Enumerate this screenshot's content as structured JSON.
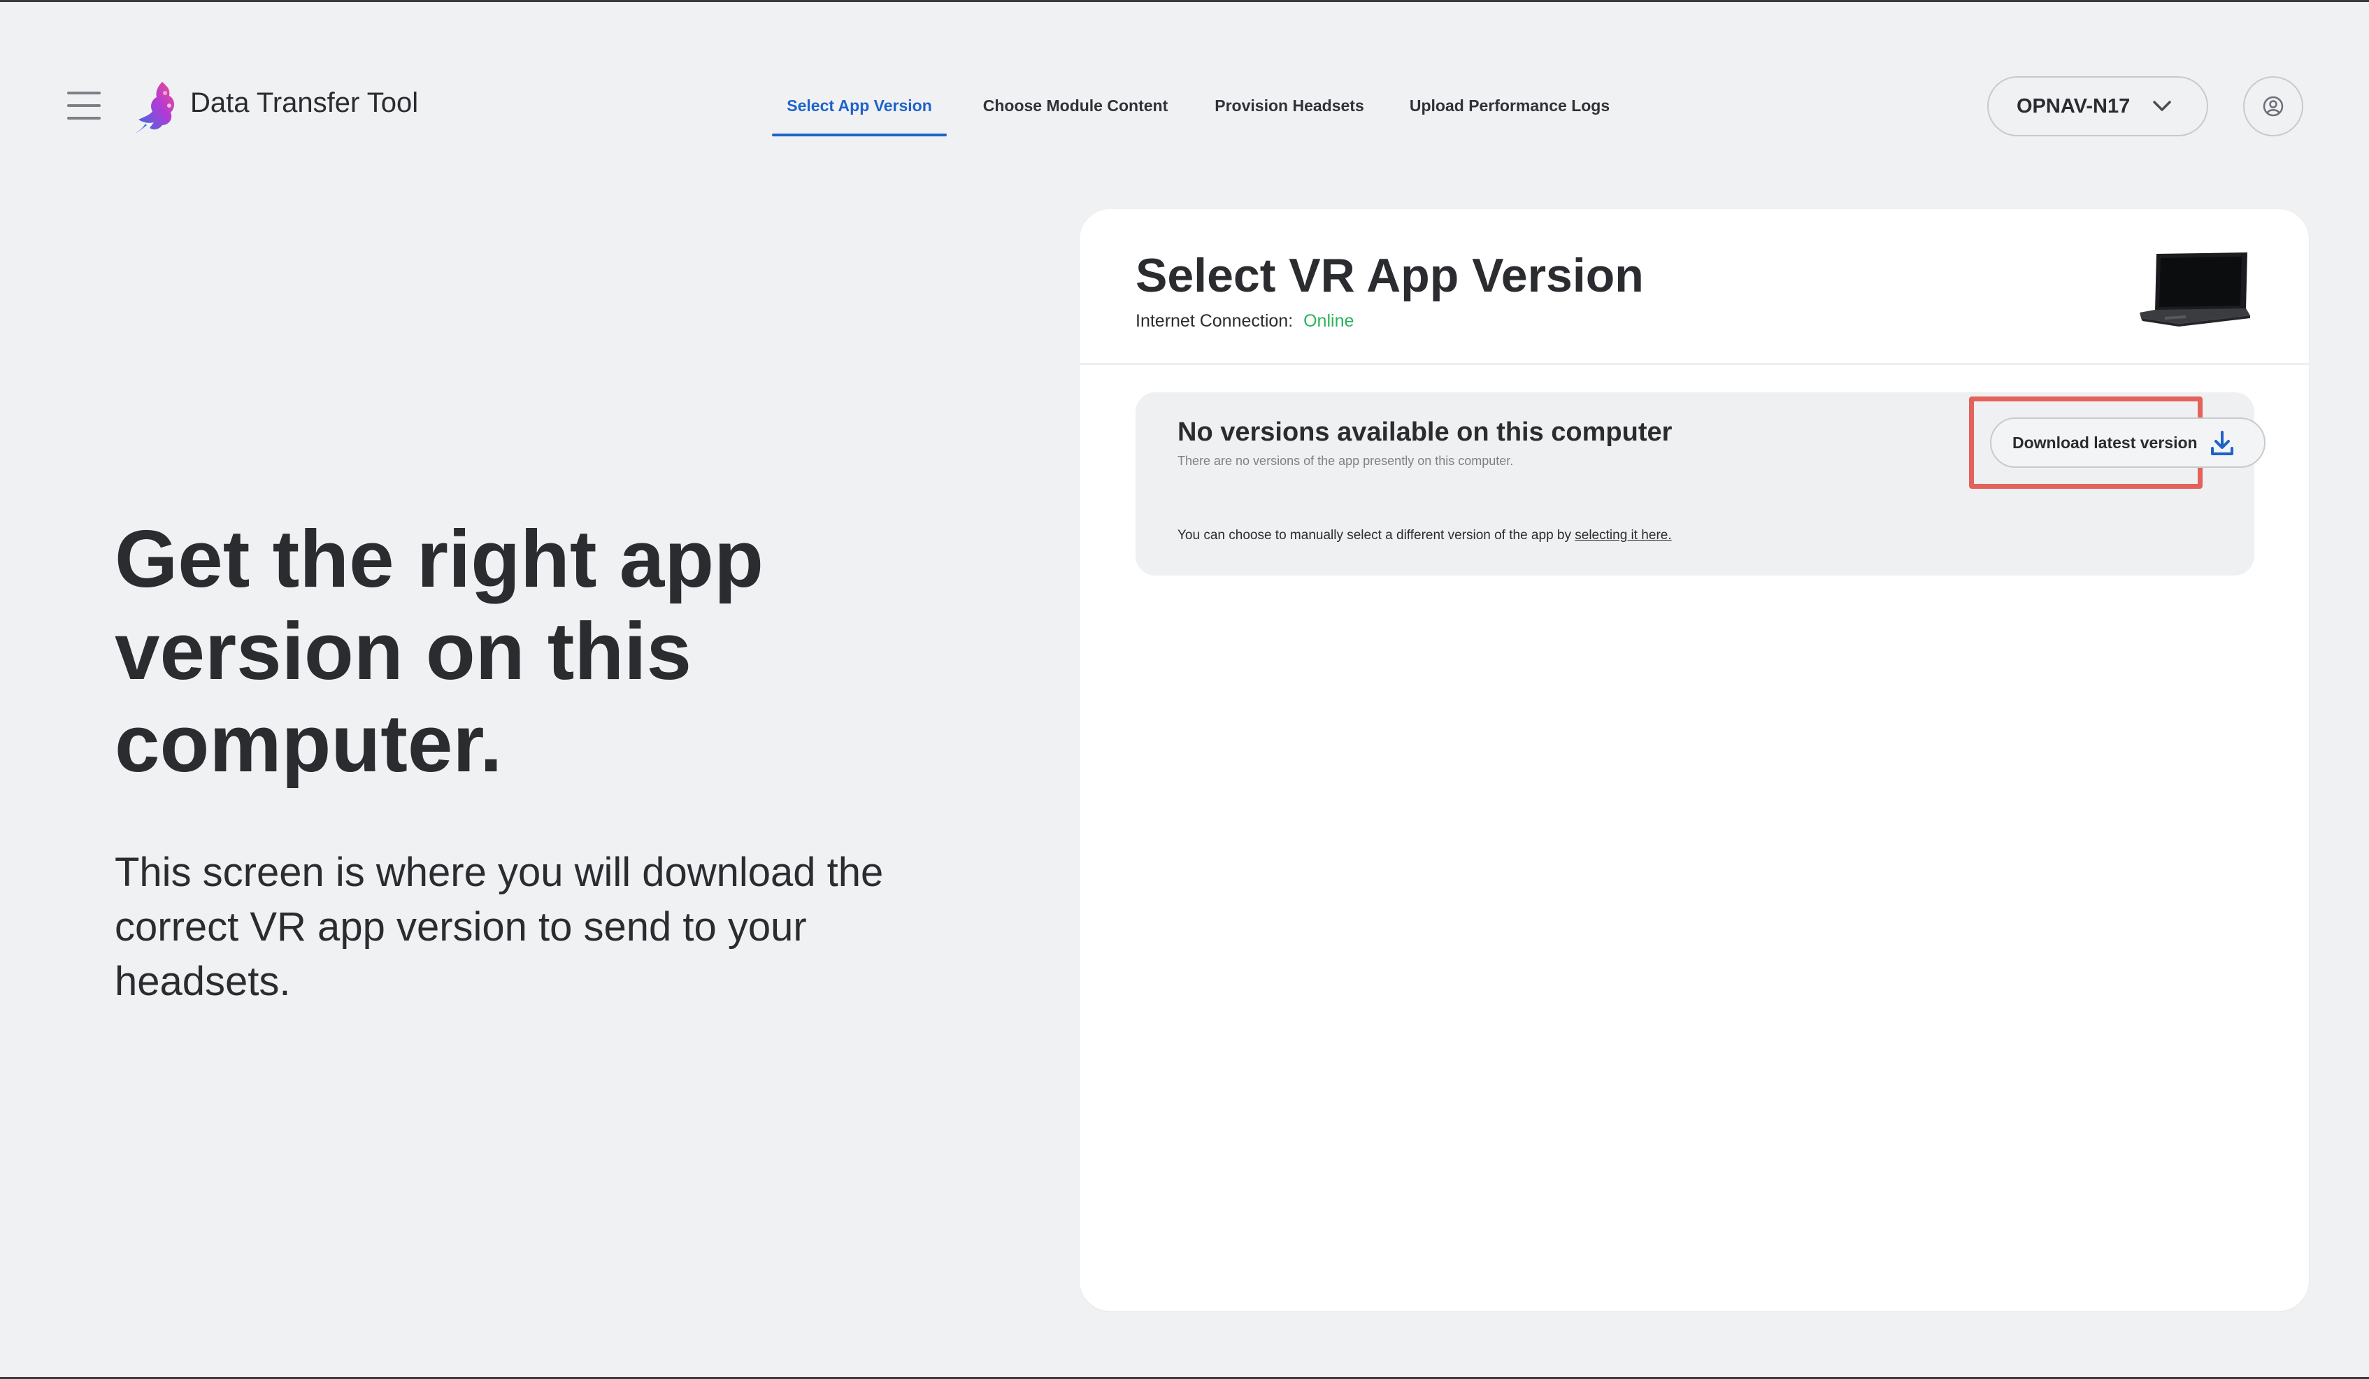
{
  "header": {
    "app_title": "Data Transfer Tool",
    "tabs": [
      {
        "label": "Select App Version",
        "active": true
      },
      {
        "label": "Choose Module Content",
        "active": false
      },
      {
        "label": "Provision Headsets",
        "active": false
      },
      {
        "label": "Upload Performance Logs",
        "active": false
      }
    ],
    "org_selector": {
      "value": "OPNAV-N17"
    },
    "icons": {
      "menu": "hamburger-menu-icon",
      "logo": "app-logo-icon",
      "dropdown": "chevron-down-icon",
      "account": "user-account-icon"
    }
  },
  "hero": {
    "title": "Get the right app version on this computer.",
    "subtitle": "This screen is where you will download the correct VR app version to send to your headsets."
  },
  "card": {
    "title": "Select VR App Version",
    "connection_label": "Internet Connection:",
    "connection_status": "Online",
    "status_color": "#2bb35a",
    "device_icon": "laptop-icon",
    "panel": {
      "title": "No versions available on this computer",
      "description": "There are no versions of the app presently on this computer.",
      "manual_prefix": "You can choose to manually select a different version of the app by ",
      "manual_link": "selecting it here.",
      "download_button": "Download latest version",
      "download_icon": "download-icon"
    }
  },
  "colors": {
    "accent": "#1e63c9",
    "highlight": "#e4625c",
    "background": "#f0f1f3"
  }
}
